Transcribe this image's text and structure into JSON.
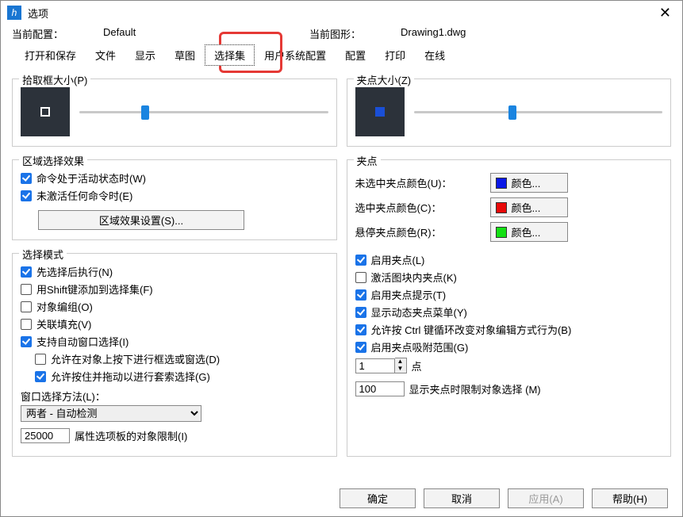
{
  "window": {
    "title": "选项"
  },
  "info": {
    "cfg_label": "当前配置：",
    "cfg_value": "Default",
    "dwg_label": "当前图形：",
    "dwg_value": "Drawing1.dwg"
  },
  "tabs": [
    "打开和保存",
    "文件",
    "显示",
    "草图",
    "选择集",
    "用户系统配置",
    "配置",
    "打印",
    "在线"
  ],
  "active_tab": 4,
  "left": {
    "pick_title": "拾取框大小(P)",
    "region_title": "区域选择效果",
    "region_active": "命令处于活动状态时(W)",
    "region_idle": "未激活任何命令时(E)",
    "region_btn": "区域效果设置(S)...",
    "mode_title": "选择模式",
    "mode_items": [
      {
        "label": "先选择后执行(N)",
        "checked": true
      },
      {
        "label": "用Shift键添加到选择集(F)",
        "checked": false
      },
      {
        "label": "对象编组(O)",
        "checked": false
      },
      {
        "label": "关联填充(V)",
        "checked": false
      },
      {
        "label": "支持自动窗口选择(I)",
        "checked": true
      }
    ],
    "mode_sub": [
      {
        "label": "允许在对象上按下进行框选或窗选(D)",
        "checked": false
      },
      {
        "label": "允许按住并拖动以进行套索选择(G)",
        "checked": true
      }
    ],
    "winsel_label": "窗口选择方法(L)：",
    "winsel_value": "两者 - 自动检测",
    "limit_value": "25000",
    "limit_label": "属性选项板的对象限制(I)"
  },
  "right": {
    "grip_title": "夹点大小(Z)",
    "grip_group": "夹点",
    "colors": [
      {
        "label": "未选中夹点颜色(U)：",
        "swatch": "#0a17e6"
      },
      {
        "label": "选中夹点颜色(C)：",
        "swatch": "#e80909"
      },
      {
        "label": "悬停夹点颜色(R)：",
        "swatch": "#14e014"
      }
    ],
    "color_btn": "颜色...",
    "grip_checks": [
      {
        "label": "启用夹点(L)",
        "checked": true
      },
      {
        "label": "激活图块内夹点(K)",
        "checked": false
      },
      {
        "label": "启用夹点提示(T)",
        "checked": true
      },
      {
        "label": "显示动态夹点菜单(Y)",
        "checked": true
      },
      {
        "label": "允许按 Ctrl 键循环改变对象编辑方式行为(B)",
        "checked": true
      },
      {
        "label": "启用夹点吸附范围(G)",
        "checked": true
      }
    ],
    "spin_value": "1",
    "spin_label": "点",
    "show_value": "100",
    "show_label": "显示夹点时限制对象选择 (M)"
  },
  "footer": {
    "ok": "确定",
    "cancel": "取消",
    "apply": "应用(A)",
    "help": "帮助(H)"
  }
}
